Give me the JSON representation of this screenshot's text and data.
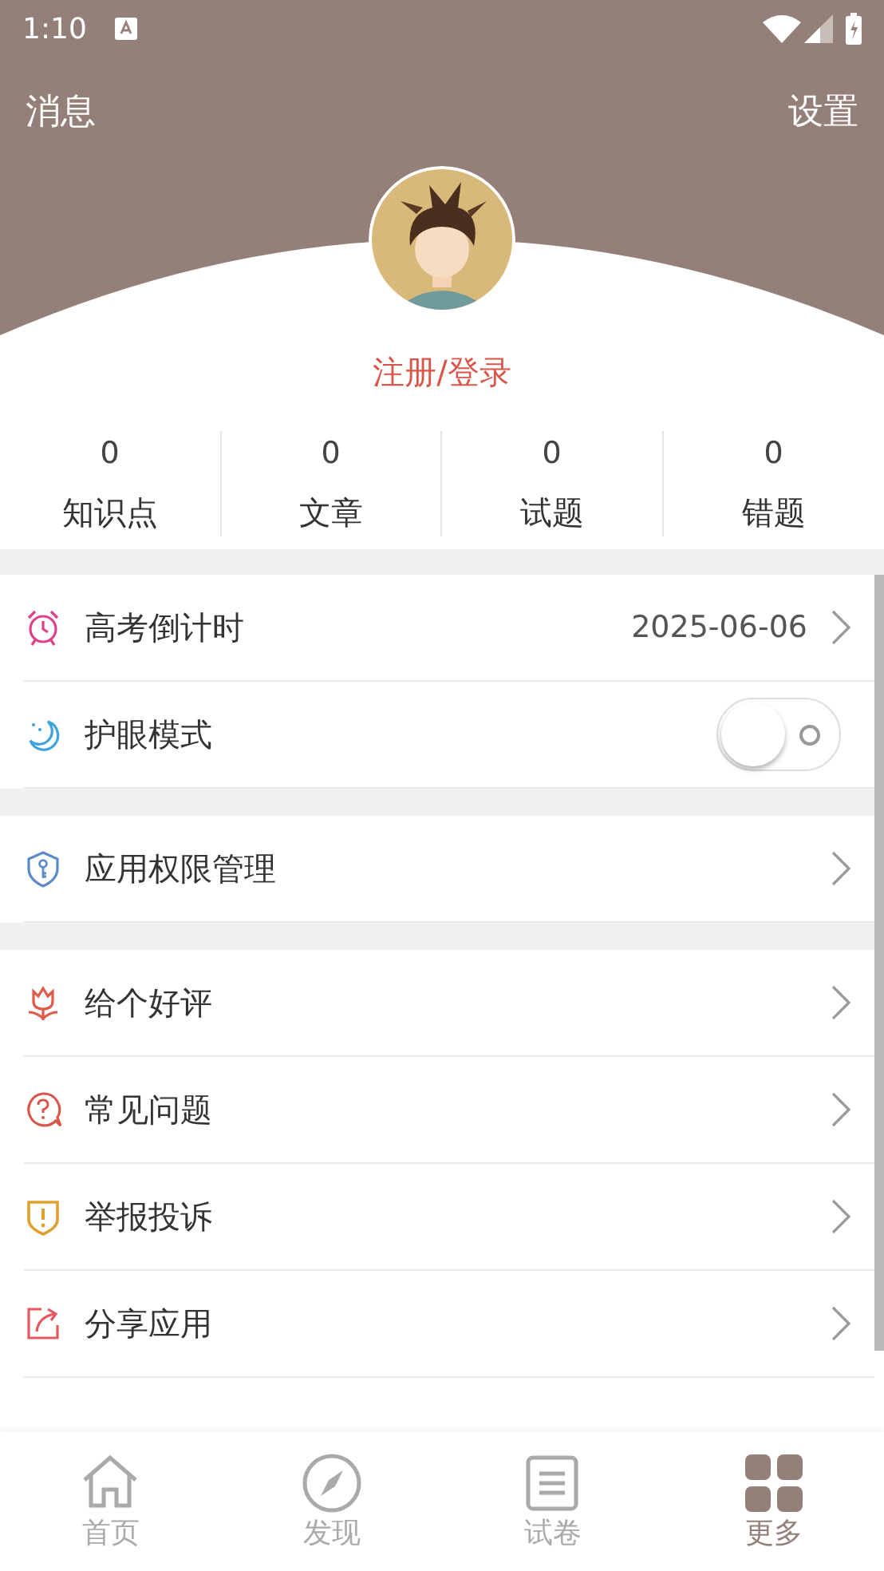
{
  "status_bar": {
    "time": "1:10"
  },
  "header": {
    "left_action": "消息",
    "right_action": "设置"
  },
  "profile": {
    "login": "注册/登录"
  },
  "stats": [
    {
      "value": "0",
      "label": "知识点"
    },
    {
      "value": "0",
      "label": "文章"
    },
    {
      "value": "0",
      "label": "试题"
    },
    {
      "value": "0",
      "label": "错题"
    }
  ],
  "sections": [
    {
      "items": [
        {
          "kind": "link",
          "label": "高考倒计时",
          "value": "2025-06-06"
        },
        {
          "kind": "toggle",
          "label": "护眼模式",
          "on": false
        }
      ]
    },
    {
      "items": [
        {
          "kind": "link",
          "label": "应用权限管理"
        }
      ]
    },
    {
      "items": [
        {
          "kind": "link",
          "label": "给个好评"
        },
        {
          "kind": "link",
          "label": "常见问题"
        },
        {
          "kind": "link",
          "label": "举报投诉"
        },
        {
          "kind": "link",
          "label": "分享应用"
        }
      ]
    }
  ],
  "tabs": [
    {
      "label": "首页",
      "selected": false
    },
    {
      "label": "发现",
      "selected": false
    },
    {
      "label": "试卷",
      "selected": false
    },
    {
      "label": "更多",
      "selected": true
    }
  ]
}
